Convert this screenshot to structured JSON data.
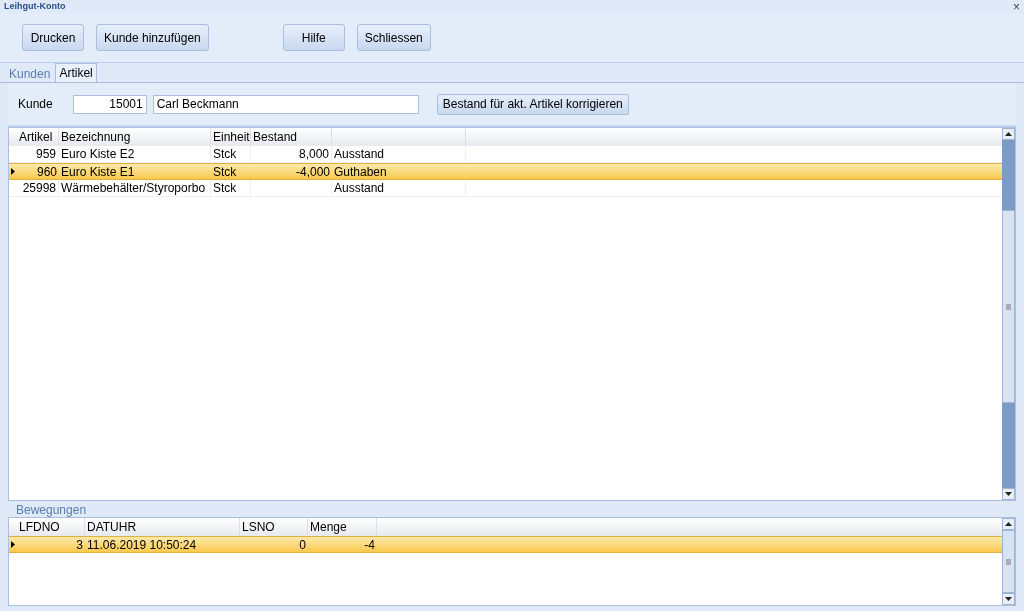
{
  "window": {
    "title": "Leihgut-Konto",
    "close": "×"
  },
  "toolbar": [
    [
      "Drucken",
      "Kunde hinzufügen"
    ],
    [
      "Hilfe",
      "Schliessen"
    ]
  ],
  "tabs": [
    {
      "label": "Kunden",
      "selected": false
    },
    {
      "label": "Artikel",
      "selected": true
    }
  ],
  "customer": {
    "label": "Kunde",
    "number": "15001",
    "name": "Carl Beckmann",
    "action": "Bestand für akt. Artikel korrigieren"
  },
  "articles": {
    "columns": [
      "Artikel",
      "Bezeichnung",
      "Einheit",
      "Bestand"
    ],
    "rows": [
      {
        "cells": [
          "959",
          "Euro Kiste E2",
          "Stck",
          "8,000",
          "Ausstand"
        ],
        "selected": false
      },
      {
        "cells": [
          "960",
          "Euro Kiste E1",
          "Stck",
          "-4,000",
          "Guthaben"
        ],
        "selected": true
      },
      {
        "cells": [
          "25998",
          "Wärmebehälter/Styroporbo",
          "Stck",
          "",
          "Ausstand"
        ],
        "selected": false
      }
    ]
  },
  "movements": {
    "title": "Bewegungen",
    "columns": [
      "LFDNO",
      "DATUHR",
      "LSNO",
      "Menge"
    ],
    "rows": [
      {
        "cells": [
          "3",
          "11.06.2019 10:50:24",
          "0",
          "-4"
        ],
        "selected": true
      }
    ]
  }
}
